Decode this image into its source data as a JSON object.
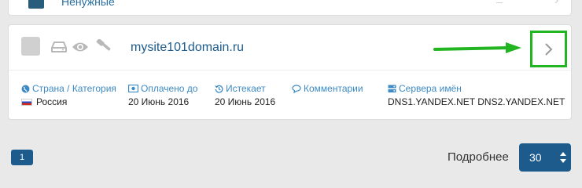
{
  "previous_card": {
    "label": "Ненужные"
  },
  "domain": {
    "name": "mysite101domain.ru",
    "fields": [
      {
        "label": "Страна / Категория",
        "value": "Россия",
        "icon": "globe-icon"
      },
      {
        "label": "Оплачено до",
        "value": "20 Июнь 2016",
        "icon": "money-icon"
      },
      {
        "label": "Истекает",
        "value": "20 Июнь 2016",
        "icon": "history-icon"
      },
      {
        "label": "Комментарии",
        "value": "",
        "icon": "comment-icon"
      },
      {
        "label": "Сервера имён",
        "value": "DNS1.YANDEX.NET DNS2.YANDEX.NET",
        "icon": "server-icon"
      }
    ]
  },
  "pagination": {
    "current_page": "1"
  },
  "per_page": {
    "label": "Подробнее",
    "value": "30"
  },
  "colors": {
    "accent": "#1d5b8c",
    "label_blue": "#3d8ac4",
    "highlight_green": "#22b522",
    "icon_gray": "#b8b8b8"
  }
}
